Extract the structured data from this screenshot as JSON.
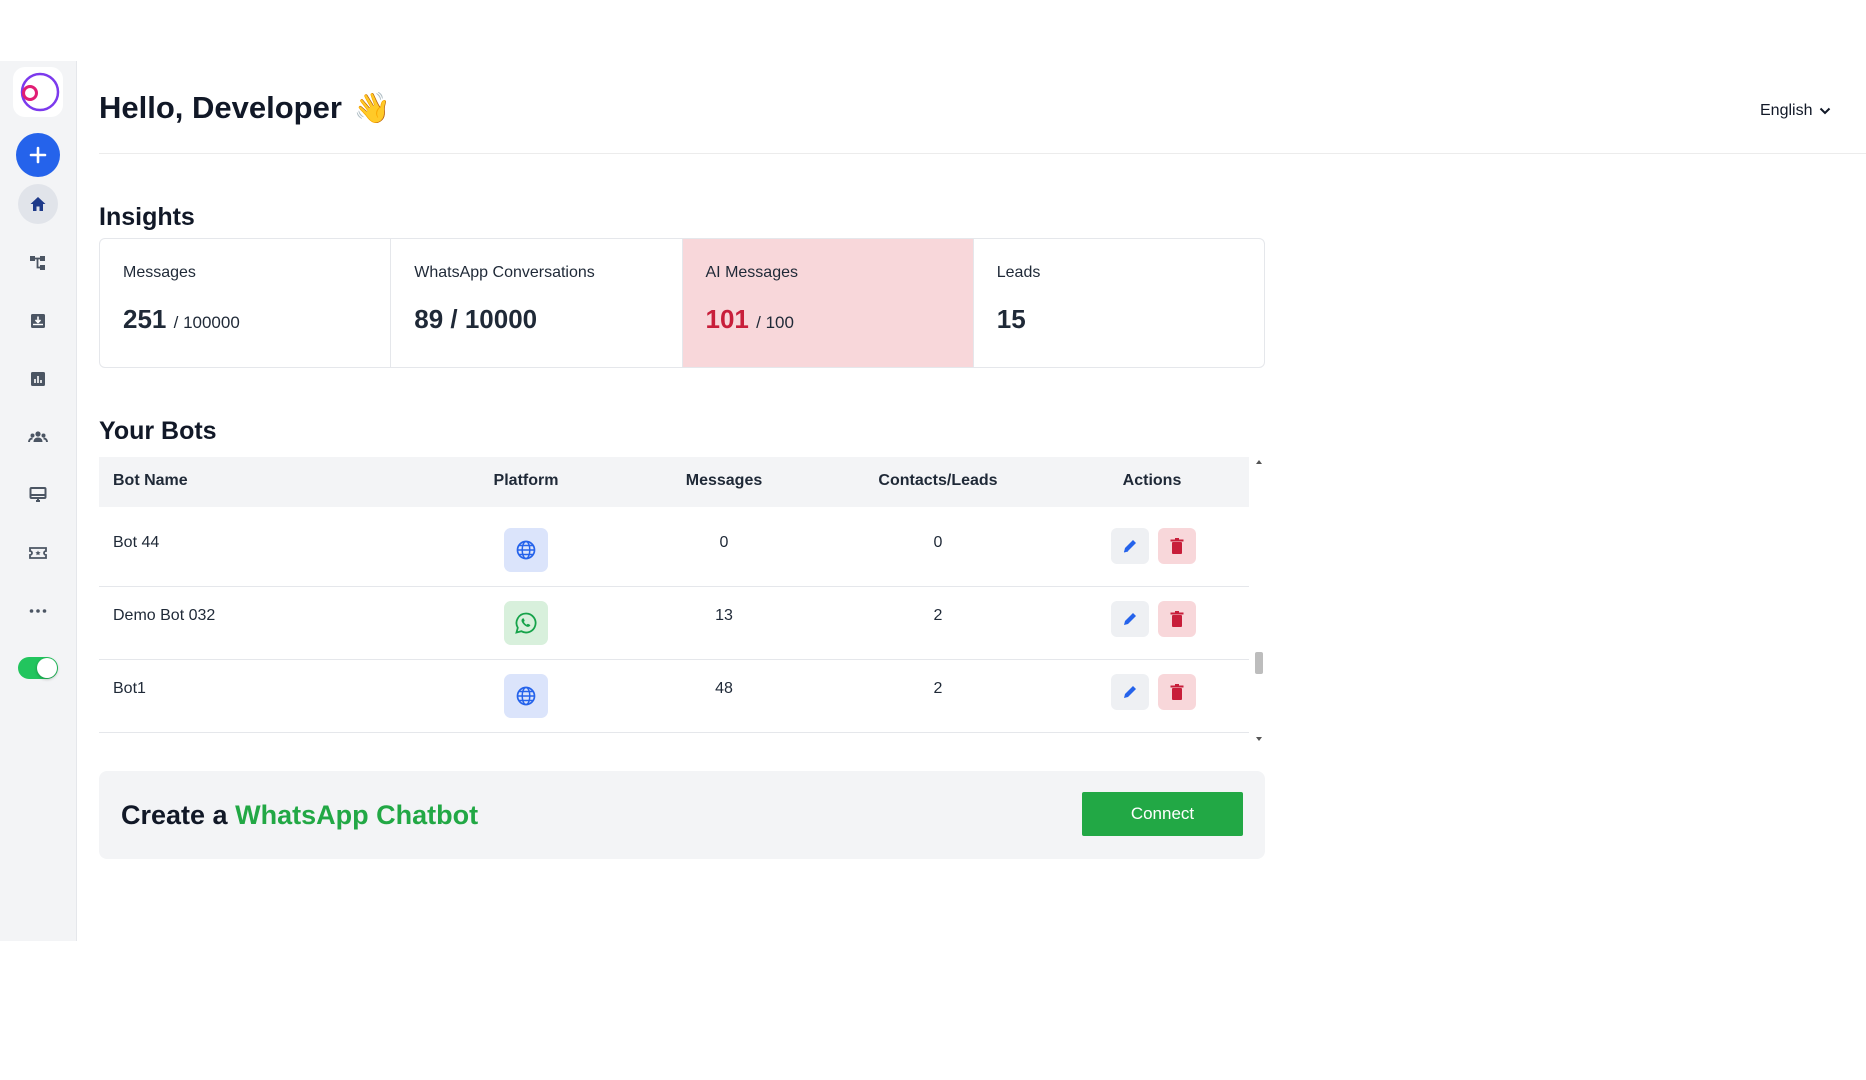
{
  "header": {
    "greeting": "Hello, Developer",
    "wave_emoji": "👋",
    "language": "English"
  },
  "sidebar": {
    "items": [
      {
        "name": "logo",
        "icon": "app-logo-icon"
      },
      {
        "name": "add",
        "icon": "plus-icon"
      },
      {
        "name": "home",
        "icon": "home-icon",
        "active": true
      },
      {
        "name": "flows",
        "icon": "flow-icon"
      },
      {
        "name": "inbox",
        "icon": "inbox-icon"
      },
      {
        "name": "analytics",
        "icon": "chart-icon"
      },
      {
        "name": "contacts",
        "icon": "users-icon"
      },
      {
        "name": "channels",
        "icon": "monitor-icon"
      },
      {
        "name": "tickets",
        "icon": "ticket-icon"
      },
      {
        "name": "more",
        "icon": "more-icon"
      },
      {
        "name": "theme-toggle",
        "icon": "toggle-icon",
        "on": true
      }
    ]
  },
  "insights": {
    "title": "Insights",
    "cards": [
      {
        "label": "Messages",
        "value": "251",
        "limit": "/ 100000"
      },
      {
        "label": "WhatsApp Conversations",
        "value": "89 / 10000",
        "limit": ""
      },
      {
        "label": "AI Messages",
        "value": "101",
        "limit": "/ 100",
        "alert": true
      },
      {
        "label": "Leads",
        "value": "15",
        "limit": ""
      }
    ]
  },
  "bots": {
    "title": "Your Bots",
    "columns": [
      "Bot Name",
      "Platform",
      "Messages",
      "Contacts/Leads",
      "Actions"
    ],
    "rows": [
      {
        "name": "Bot 44",
        "platform": "web",
        "platform_icon": "globe-icon",
        "messages": "0",
        "contacts": "0"
      },
      {
        "name": "Demo Bot 032",
        "platform": "whatsapp",
        "platform_icon": "whatsapp-icon",
        "messages": "13",
        "contacts": "2"
      },
      {
        "name": "Bot1",
        "platform": "web",
        "platform_icon": "globe-icon",
        "messages": "48",
        "contacts": "2"
      }
    ]
  },
  "cta": {
    "prefix": "Create a",
    "highlight": "WhatsApp Chatbot",
    "button": "Connect"
  },
  "colors": {
    "primary_blue": "#2563eb",
    "whatsapp_green": "#22a845",
    "alert_bg": "#f8d7da",
    "alert_text": "#c81e3a"
  }
}
